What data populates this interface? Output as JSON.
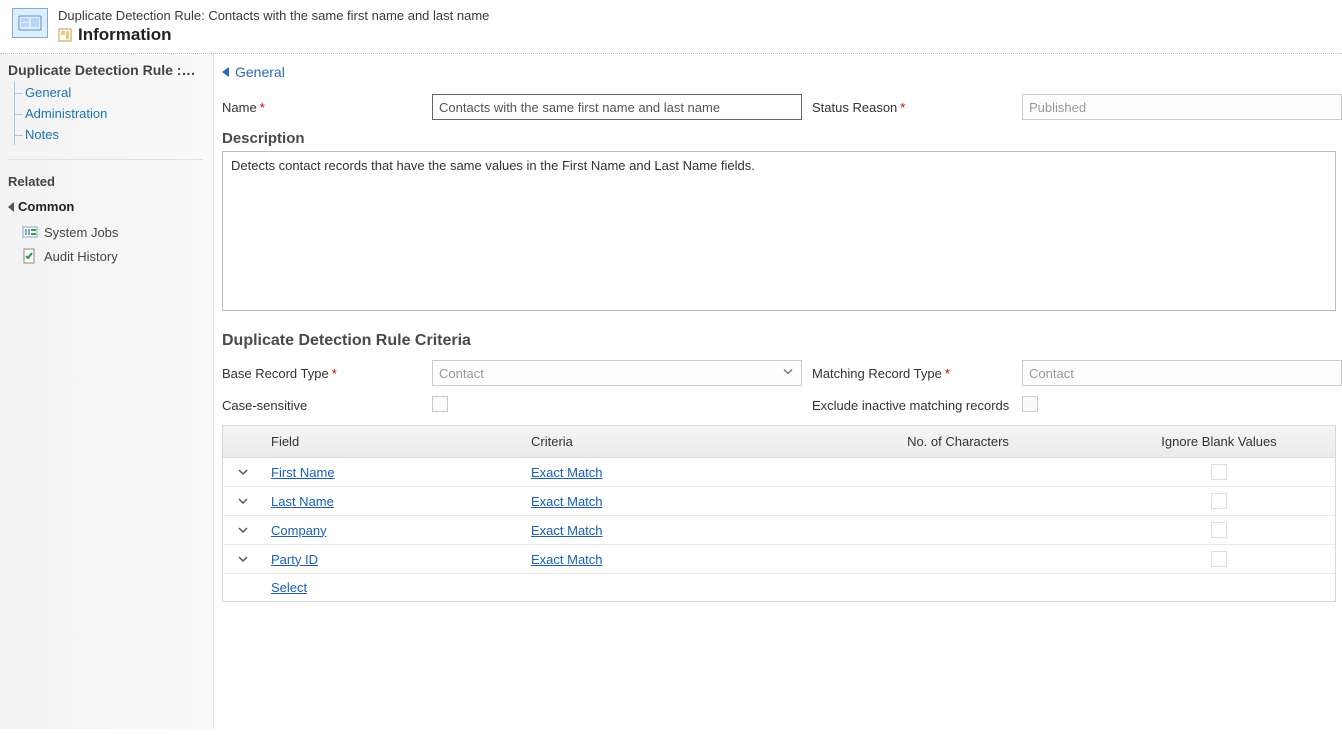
{
  "header": {
    "title_prefix": "Duplicate Detection Rule: ",
    "title_name": "Contacts with the same first name and last name",
    "info_label": "Information"
  },
  "sidebar": {
    "title": "Duplicate Detection Rule :…",
    "nav": [
      {
        "label": "General"
      },
      {
        "label": "Administration"
      },
      {
        "label": "Notes"
      }
    ],
    "related_label": "Related",
    "groups": [
      {
        "label": "Common",
        "items": [
          {
            "icon": "jobs-icon",
            "label": "System Jobs"
          },
          {
            "icon": "audit-icon",
            "label": "Audit History"
          }
        ]
      }
    ]
  },
  "general": {
    "section_label": "General",
    "name_label": "Name",
    "name_value": "Contacts with the same first name and last name",
    "status_label": "Status Reason",
    "status_value": "Published",
    "description_label": "Description",
    "description_value": "Detects contact records that have the same values in the First Name and Last Name fields."
  },
  "criteria": {
    "title": "Duplicate Detection Rule Criteria",
    "base_type_label": "Base Record Type",
    "base_type_value": "Contact",
    "matching_type_label": "Matching Record Type",
    "matching_type_value": "Contact",
    "case_sensitive_label": "Case-sensitive",
    "exclude_inactive_label": "Exclude inactive matching records",
    "columns": {
      "field": "Field",
      "criteria": "Criteria",
      "chars": "No. of Characters",
      "ignore_blank": "Ignore Blank Values"
    },
    "rows": [
      {
        "field": "First Name",
        "criteria": "Exact Match"
      },
      {
        "field": "Last Name",
        "criteria": "Exact Match"
      },
      {
        "field": "Company",
        "criteria": "Exact Match"
      },
      {
        "field": "Party ID",
        "criteria": "Exact Match"
      }
    ],
    "select_label": "Select"
  }
}
